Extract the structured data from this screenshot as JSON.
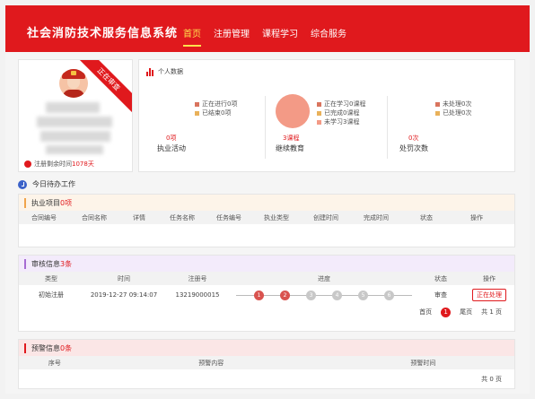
{
  "header": {
    "title": "社会消防技术服务信息系统",
    "nav": [
      "首页",
      "注册管理",
      "课程学习",
      "综合服务"
    ],
    "active_nav": "首页"
  },
  "profile": {
    "ribbon": "正在审查",
    "remain_label": "注册剩余时间",
    "remain_days": "1078天"
  },
  "stats": {
    "title": "个人数据",
    "practice": {
      "legend": [
        "正在进行0项",
        "已结束0项"
      ],
      "legend_colors": [
        "#d9745e",
        "#e9b15a"
      ],
      "value": "0项",
      "label": "执业活动"
    },
    "education": {
      "legend": [
        "正在学习0课程",
        "已完成0课程",
        "未学习3课程"
      ],
      "legend_colors": [
        "#d9745e",
        "#e9b15a",
        "#f39a86"
      ],
      "value": "3课程",
      "label": "继续教育"
    },
    "penalty": {
      "legend": [
        "未处理0次",
        "已处理0次"
      ],
      "legend_colors": [
        "#d9745e",
        "#e9b15a"
      ],
      "value": "0次",
      "label": "处罚次数"
    }
  },
  "todo": {
    "title": "今日待办工作"
  },
  "practice_items": {
    "title": "执业项目",
    "count": "0项",
    "accent": "#f0a44b",
    "columns": [
      "合同编号",
      "合同名称",
      "详情",
      "任务名称",
      "任务编号",
      "执业类型",
      "创建时间",
      "完成时间",
      "状态",
      "操作"
    ]
  },
  "review": {
    "title": "审核信息",
    "count": "3条",
    "accent": "#a66bd3",
    "columns": [
      "类型",
      "时间",
      "注册号",
      "进度",
      "状态",
      "操作"
    ],
    "rows": [
      {
        "type": "初始注册",
        "time": "2019-12-27 09:14:07",
        "reg_no": "13219000015",
        "steps": [
          "1",
          "2",
          "3",
          "4",
          "5",
          "6"
        ],
        "steps_done": 2,
        "status": "审查",
        "action": "正在处理"
      }
    ],
    "pager": {
      "first": "首页",
      "current": "1",
      "last": "尾页",
      "total": "共 1 页"
    }
  },
  "warning": {
    "title": "预警信息",
    "count": "0条",
    "accent": "#e0191d",
    "columns": [
      "序号",
      "预警内容",
      "预警时间"
    ],
    "pager": {
      "total": "共 0 页"
    }
  }
}
